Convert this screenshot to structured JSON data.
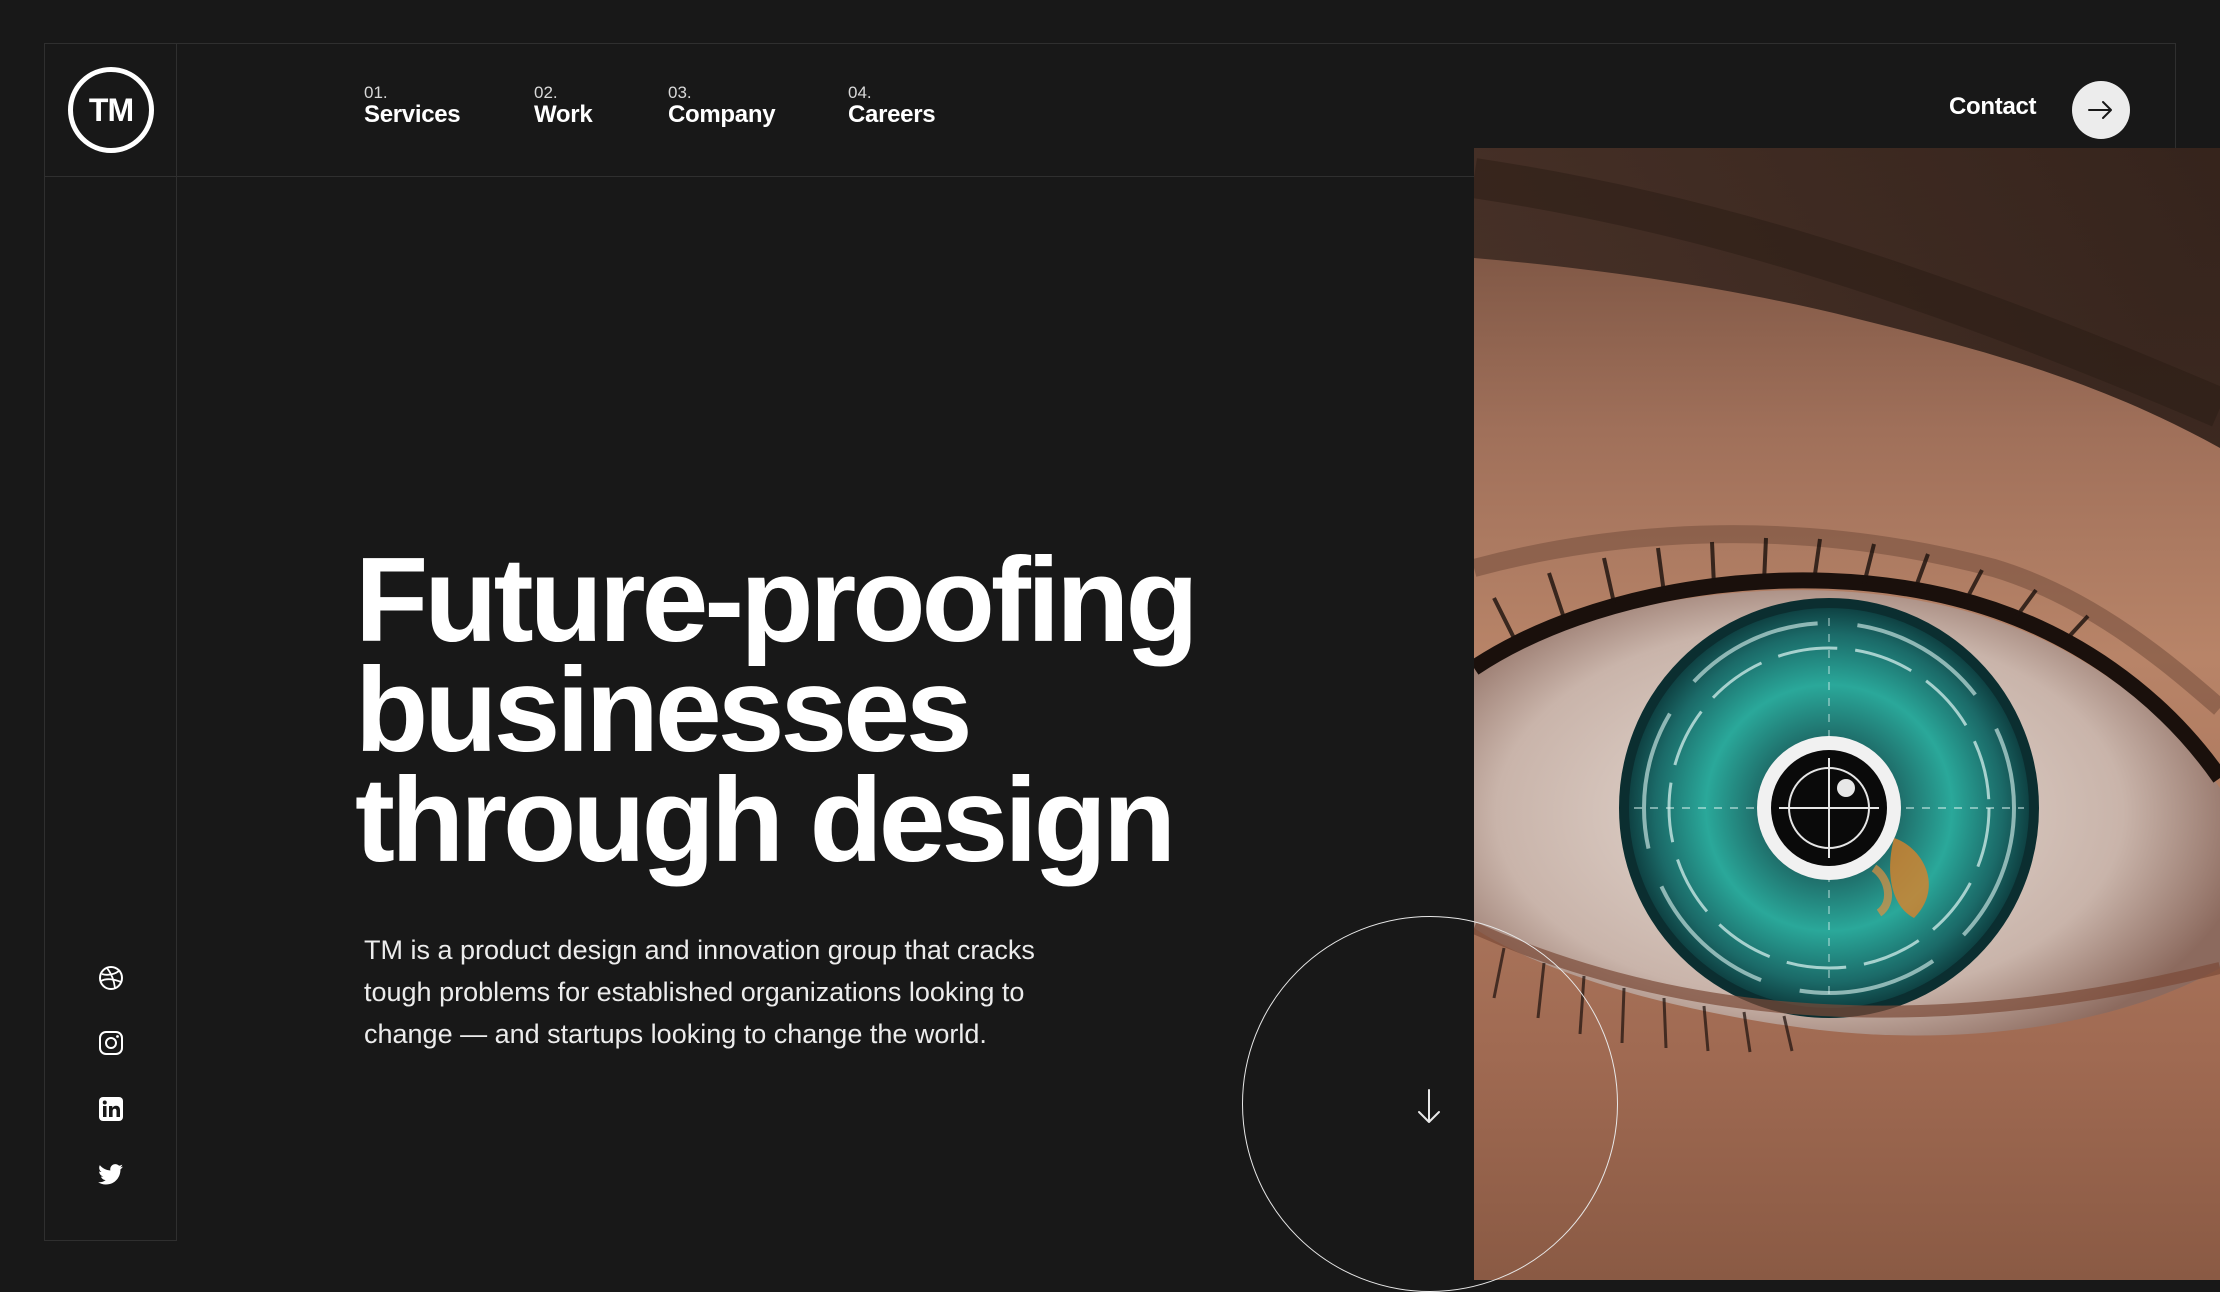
{
  "brand": {
    "logo_text": "TM"
  },
  "nav": {
    "items": [
      {
        "number": "01.",
        "label": "Services"
      },
      {
        "number": "02.",
        "label": "Work"
      },
      {
        "number": "03.",
        "label": "Company"
      },
      {
        "number": "04.",
        "label": "Careers"
      }
    ],
    "contact_label": "Contact"
  },
  "hero": {
    "title_lines": [
      "Future-proofing",
      "businesses",
      "through design"
    ],
    "description": "TM is a product design and innovation group that cracks tough problems for established organizations looking to change — and startups looking to change the world."
  },
  "social": [
    "dribbble-icon",
    "instagram-icon",
    "linkedin-icon",
    "twitter-icon"
  ],
  "colors": {
    "background": "#181818",
    "text": "#ffffff",
    "iris": "#2a9d8f",
    "accent_orange": "#d9822b"
  }
}
